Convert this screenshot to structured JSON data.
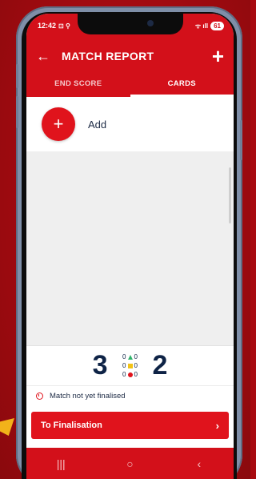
{
  "status": {
    "time": "12:42",
    "left_icons": "⊡ ⚲",
    "signal": "ᯤ ıll",
    "battery": "61"
  },
  "appbar": {
    "back_icon": "arrow-left-icon",
    "title": "MATCH REPORT",
    "add_icon": "plus-icon"
  },
  "tabs": [
    {
      "label": "END SCORE",
      "active": false
    },
    {
      "label": "CARDS",
      "active": true
    }
  ],
  "add_row": {
    "label": "Add"
  },
  "score": {
    "home": "3",
    "away": "2",
    "green": "0",
    "yellow": "0",
    "red": "0",
    "green2": "0",
    "yellow2": "0",
    "red2": "0"
  },
  "notice": {
    "text": "Match not yet finalised"
  },
  "finalise": {
    "label": "To Finalisation",
    "chevron": "›"
  },
  "navbar": {
    "recents": "|||",
    "home": "○",
    "back": "‹"
  },
  "colors": {
    "brand_red": "#d3101a",
    "accent_red": "#e0131c",
    "navy": "#0e2346"
  }
}
